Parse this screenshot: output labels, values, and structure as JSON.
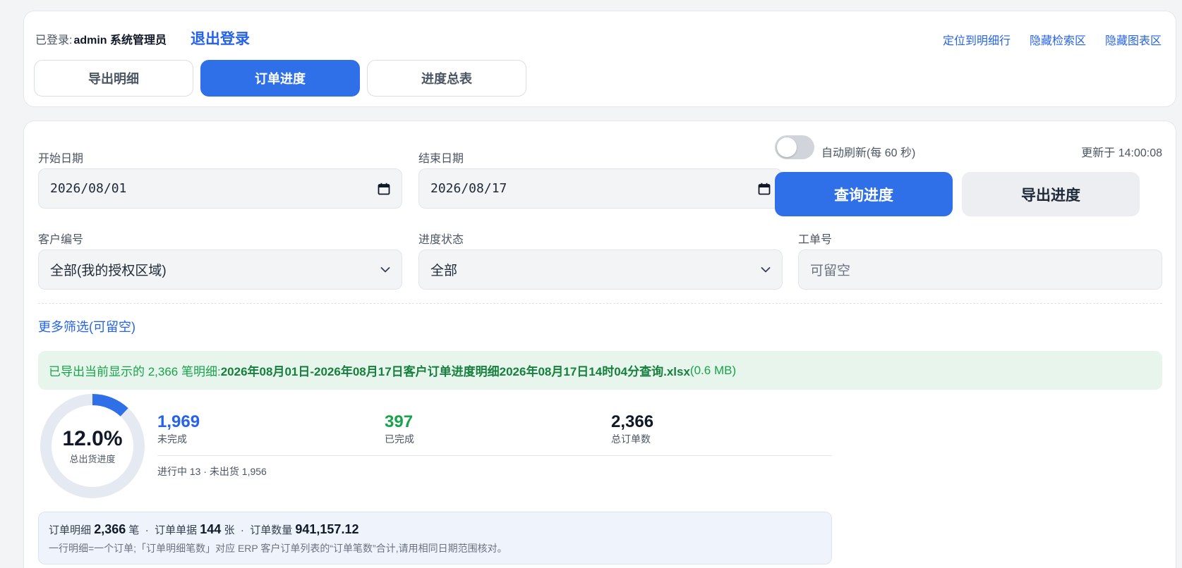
{
  "header": {
    "login_prefix": "已登录:",
    "user_name": "admin 系统管理员",
    "logout_label": "退出登录",
    "links": [
      "定位到明细行",
      "隐藏检索区",
      "隐藏图表区"
    ]
  },
  "tabs": [
    {
      "label": "导出明细",
      "active": false
    },
    {
      "label": "订单进度",
      "active": true
    },
    {
      "label": "进度总表",
      "active": false
    }
  ],
  "filters": {
    "start_date_label": "开始日期",
    "start_date_value": "2026/08/01",
    "end_date_label": "结束日期",
    "end_date_value": "2026/08/17",
    "customer_label": "客户编号",
    "customer_value": "全部(我的授权区域)",
    "status_label": "进度状态",
    "status_value": "全部",
    "workorder_label": "工单号",
    "workorder_placeholder": "可留空",
    "more_filters": "更多筛选(可留空)"
  },
  "controls": {
    "auto_refresh_label": "自动刷新(每 60 秒)",
    "auto_refresh_on": false,
    "updated_text": "更新于 14:00:08",
    "query_button": "查询进度",
    "export_button": "导出进度"
  },
  "notice": {
    "prefix": "已导出当前显示的 2,366 笔明细:",
    "filename": "2026年08月01日-2026年08月17日客户订单进度明细2026年08月17日14时04分查询.xlsx",
    "size": "(0.6 MB)"
  },
  "progress": {
    "percent_text": "12.0%",
    "percent_value": 12.0,
    "label": "总出货进度"
  },
  "stats": [
    {
      "value": "1,969",
      "label": "未完成",
      "color": "#2563eb"
    },
    {
      "value": "397",
      "label": "已完成",
      "color": "#16a34a"
    },
    {
      "value": "2,366",
      "label": "总订单数",
      "color": "#111827"
    }
  ],
  "sub_stats": "进行中 13 · 未出货 1,956",
  "summary": {
    "detail_label": "订单明细",
    "detail_value": "2,366",
    "detail_unit": "笔",
    "doc_label": "订单单据",
    "doc_value": "144",
    "doc_unit": "张",
    "qty_label": "订单数量",
    "qty_value": "941,157.12",
    "note": "一行明细=一个订单;「订单明细笔数」对应 ERP 客户订单列表的“订单笔数”合计,请用相同日期范围核对。"
  },
  "colors": {
    "accent": "#2f6fe8",
    "donut_track": "#e5e9f1",
    "donut_fill": "#2f6fe8"
  }
}
